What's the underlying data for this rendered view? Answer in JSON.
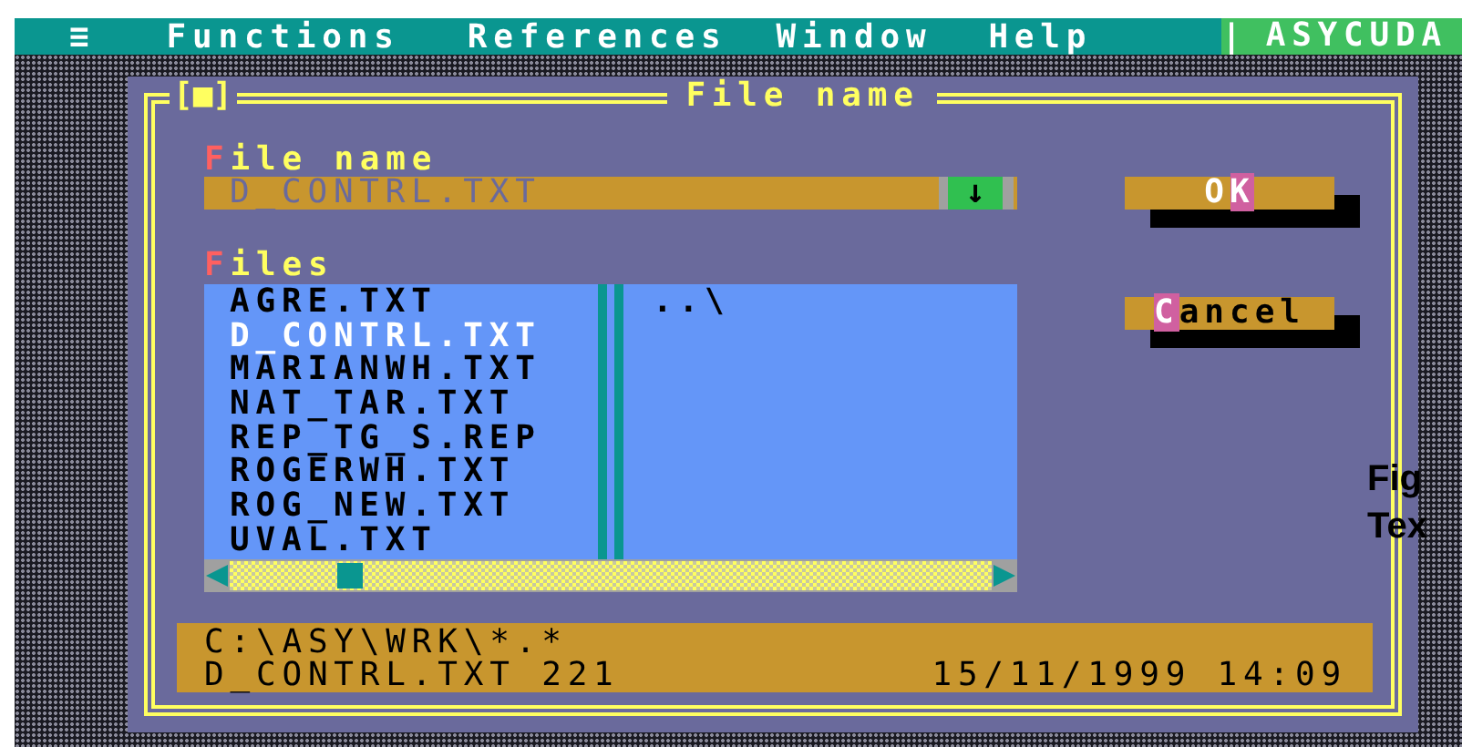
{
  "menu_bar": {
    "items": [
      {
        "label": "≡"
      },
      {
        "label": "Functions"
      },
      {
        "label": "References"
      },
      {
        "label": "Window"
      },
      {
        "label": "Help"
      }
    ],
    "separator": "|",
    "app_name": "ASYCUDA"
  },
  "dialog": {
    "close_box": "[■]",
    "title": "File name",
    "file_name": {
      "label": {
        "hotkey": "F",
        "rest": "ile name"
      },
      "value": "D_CONTRL.TXT",
      "dropdown": "↓"
    },
    "files": {
      "label": {
        "hotkey": "F",
        "rest": "iles"
      },
      "column_1": [
        {
          "name": "AGRE.TXT",
          "selected": false
        },
        {
          "name": "D_CONTRL.TXT",
          "selected": true
        },
        {
          "name": "MARIANWH.TXT",
          "selected": false
        },
        {
          "name": "NAT_TAR.TXT",
          "selected": false
        },
        {
          "name": "REP_TG_S.REP",
          "selected": false
        },
        {
          "name": "ROGERWH.TXT",
          "selected": false
        },
        {
          "name": "ROG_NEW.TXT",
          "selected": false
        },
        {
          "name": "UVAL.TXT",
          "selected": false
        }
      ],
      "column_2": [
        {
          "name": "..\\",
          "selected": false
        }
      ]
    },
    "buttons": [
      {
        "label": {
          "before": "O",
          "hotkey": "K"
        },
        "default": true
      },
      {
        "label": {
          "hotkey": "C",
          "rest": "ancel"
        },
        "default": false
      }
    ],
    "info": {
      "path": "C:\\ASY\\WRK\\*.*",
      "file": "D_CONTRL.TXT 221",
      "date": "15/11/1999 14:09"
    }
  },
  "document_text": [
    "Fig",
    "Tex"
  ]
}
